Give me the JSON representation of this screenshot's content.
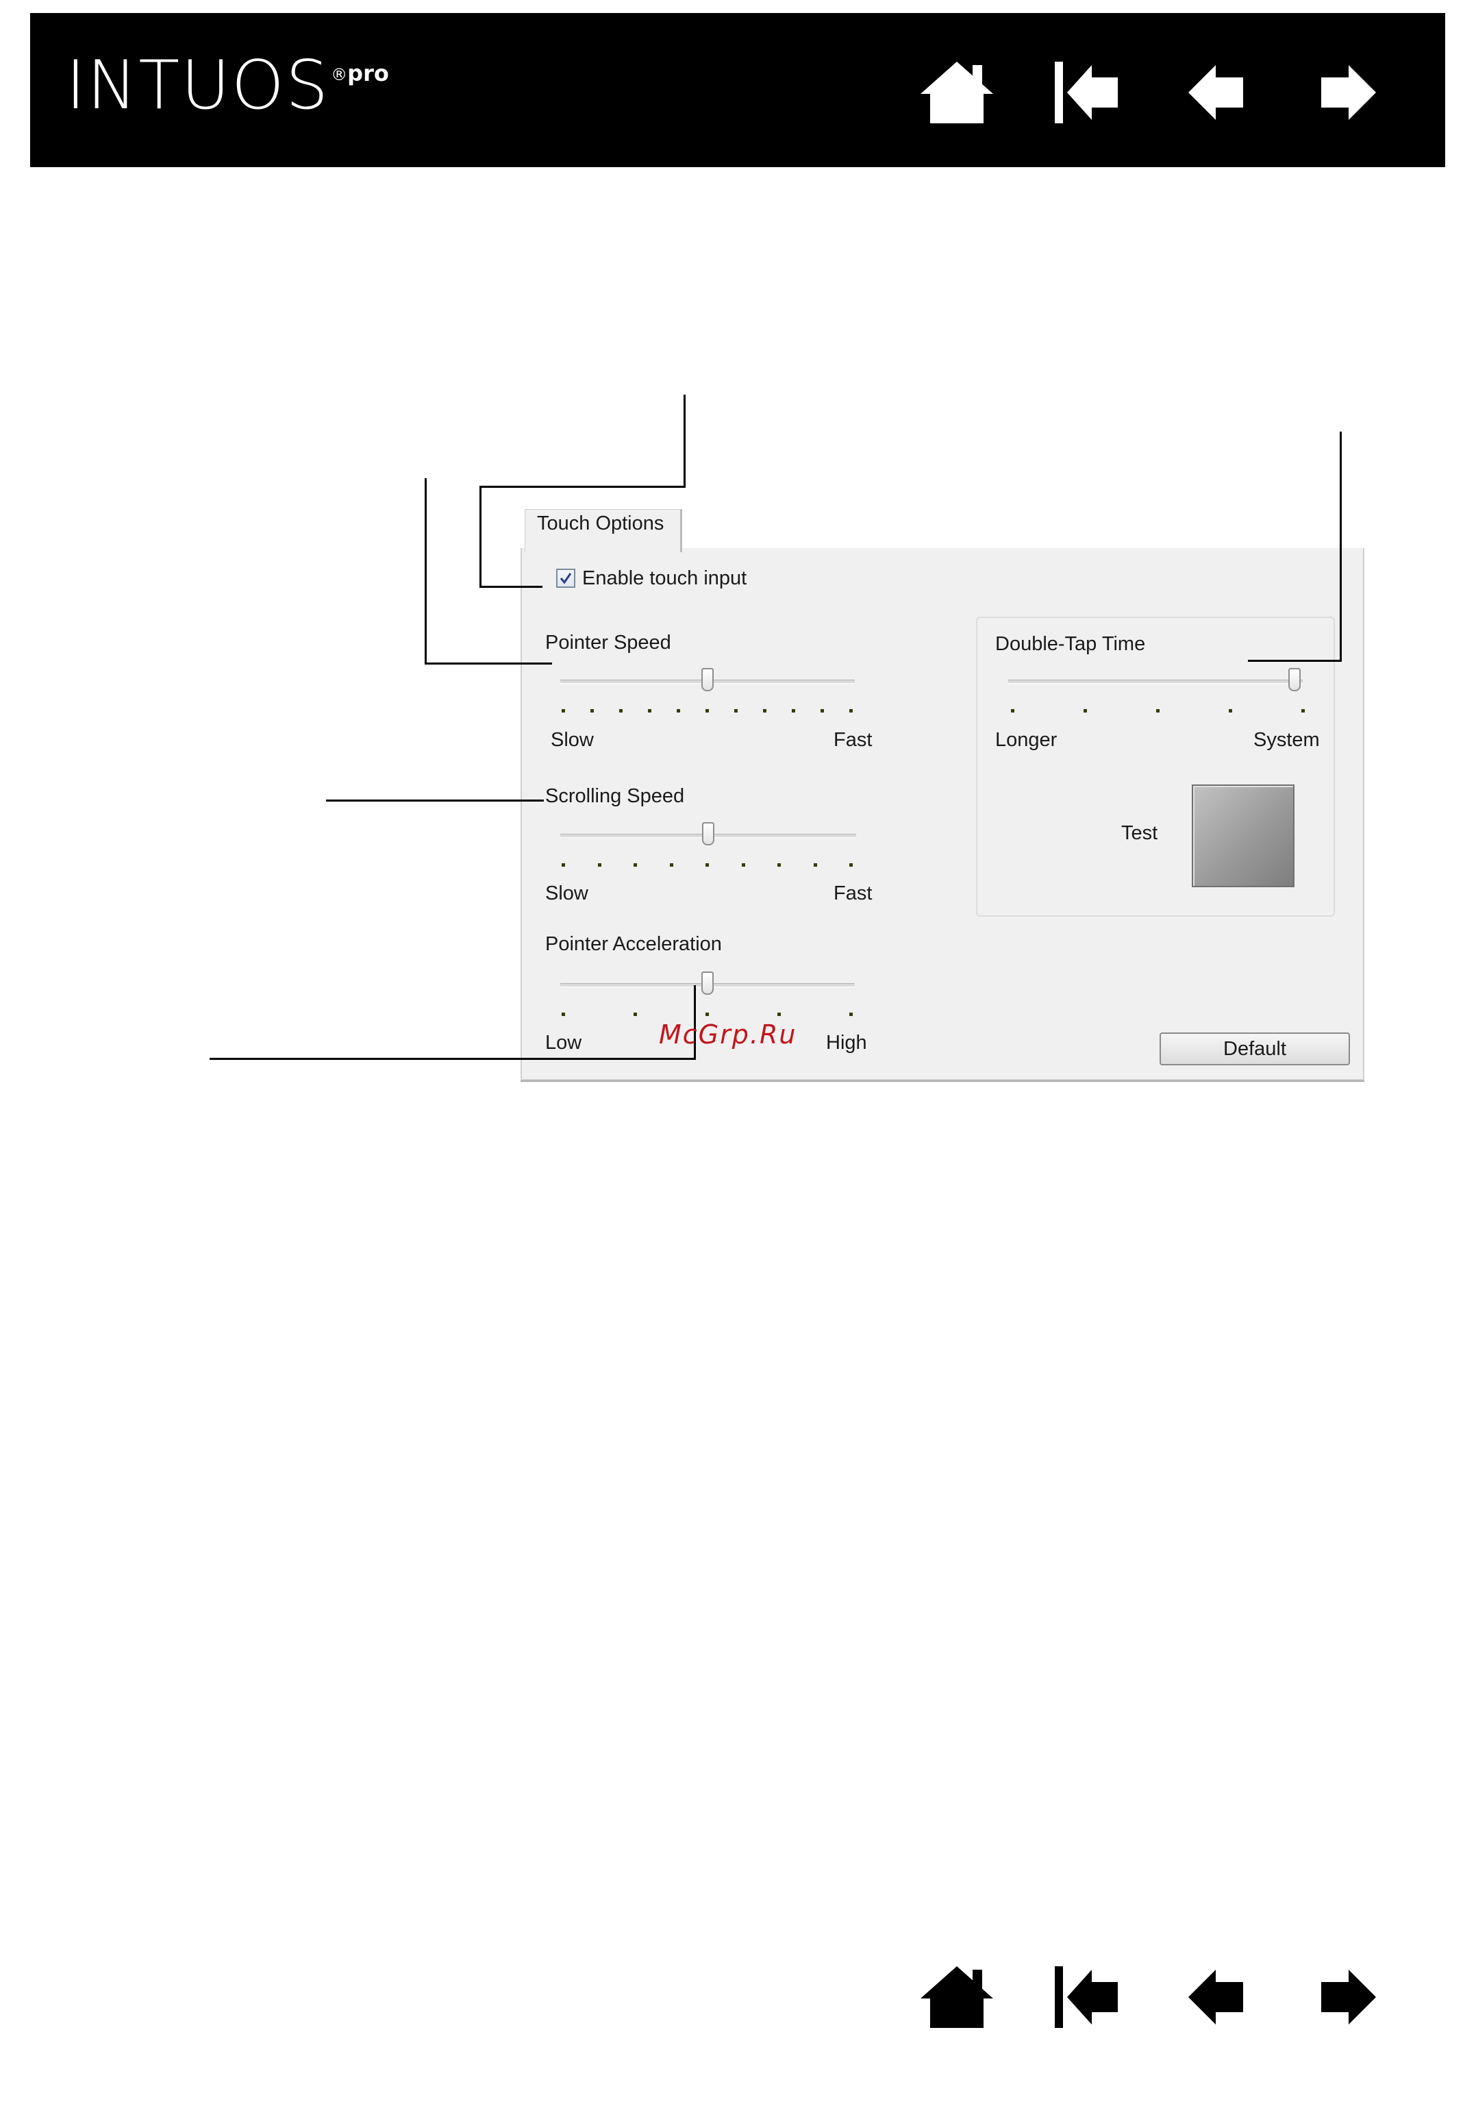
{
  "header": {
    "logo_main": "INTUOS",
    "logo_registered": "®",
    "logo_suffix": "pro",
    "nav_icons": [
      "home-icon",
      "first-page-icon",
      "previous-page-icon",
      "next-page-icon"
    ]
  },
  "dialog": {
    "tab_label": "Touch Options",
    "enable_touch_label": "Enable touch input",
    "enable_touch_checked": true,
    "pointer_speed": {
      "label": "Pointer Speed",
      "min_label": "Slow",
      "max_label": "Fast",
      "value_fraction": 0.5,
      "tick_count": 11
    },
    "scrolling_speed": {
      "label": "Scrolling Speed",
      "min_label": "Slow",
      "max_label": "Fast",
      "value_fraction": 0.5,
      "tick_count": 9
    },
    "pointer_acceleration": {
      "label": "Pointer Acceleration",
      "min_label": "Low",
      "max_label": "High",
      "value_fraction": 0.5,
      "tick_count": 5
    },
    "double_tap_time": {
      "label": "Double-Tap Time",
      "min_label": "Longer",
      "max_label": "System",
      "value_fraction": 1.0,
      "tick_count": 5
    },
    "test_label": "Test",
    "default_button": "Default"
  },
  "watermark": "McGrp.Ru",
  "colors": {
    "header_bg": "#000000",
    "dialog_bg": "#f0f0f0",
    "watermark": "#c0161c"
  }
}
